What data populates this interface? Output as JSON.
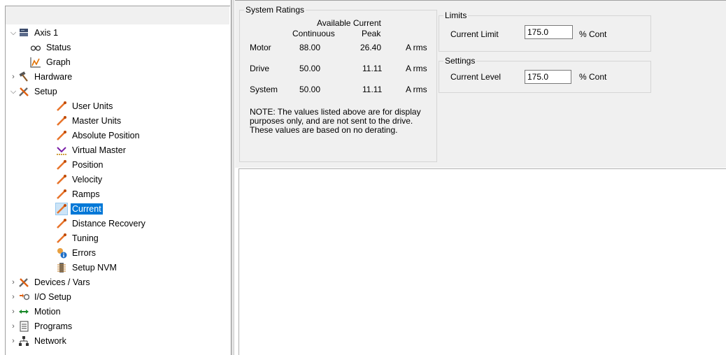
{
  "tree": {
    "nodes": [
      {
        "label": "Axis 1",
        "icon": "axis-drive-icon",
        "expander": "expanded"
      },
      {
        "label": "Status",
        "icon": "status-glasses-icon"
      },
      {
        "label": "Graph",
        "icon": "graph-icon"
      },
      {
        "label": "Hardware",
        "icon": "hammer-icon",
        "expander": "collapsed"
      },
      {
        "label": "Setup",
        "icon": "tools-icon",
        "expander": "expanded"
      },
      {
        "label": "User Units",
        "icon": "orange-tool-icon"
      },
      {
        "label": "Master Units",
        "icon": "orange-tool-icon"
      },
      {
        "label": "Absolute Position",
        "icon": "orange-tool-icon"
      },
      {
        "label": "Virtual Master",
        "icon": "virtual-master-icon"
      },
      {
        "label": "Position",
        "icon": "orange-tool-icon"
      },
      {
        "label": "Velocity",
        "icon": "orange-tool-icon"
      },
      {
        "label": "Ramps",
        "icon": "orange-tool-icon"
      },
      {
        "label": "Current",
        "icon": "orange-tool-icon",
        "selected": true
      },
      {
        "label": "Distance Recovery",
        "icon": "orange-tool-icon"
      },
      {
        "label": "Tuning",
        "icon": "orange-tool-icon"
      },
      {
        "label": "Errors",
        "icon": "errors-info-icon"
      },
      {
        "label": "Setup NVM",
        "icon": "nvm-memory-icon"
      },
      {
        "label": "Devices / Vars",
        "icon": "tools-icon",
        "expander": "collapsed"
      },
      {
        "label": "I/O Setup",
        "icon": "io-setup-icon",
        "expander": "collapsed"
      },
      {
        "label": "Motion",
        "icon": "motion-arrows-icon",
        "expander": "collapsed"
      },
      {
        "label": "Programs",
        "icon": "programs-icon",
        "expander": "collapsed"
      },
      {
        "label": "Network",
        "icon": "network-icon",
        "expander": "collapsed"
      }
    ]
  },
  "ratings": {
    "title": "System Ratings",
    "header_available": "Available Current",
    "header_continuous": "Continuous",
    "header_peak": "Peak",
    "rows": [
      {
        "name": "Motor",
        "continuous": "88.00",
        "peak": "26.40",
        "unit": "A rms"
      },
      {
        "name": "Drive",
        "continuous": "50.00",
        "peak": "11.11",
        "unit": "A rms"
      },
      {
        "name": "System",
        "continuous": "50.00",
        "peak": "11.11",
        "unit": "A rms"
      }
    ],
    "note": "NOTE:  The values listed above are for display purposes only, and are not sent to the drive.  These values are based on no derating."
  },
  "limits": {
    "title": "Limits",
    "label": "Current Limit",
    "value": "175.0",
    "unit": "% Cont"
  },
  "settings": {
    "title": "Settings",
    "label": "Current Level",
    "value": "175.0",
    "unit": "% Cont"
  }
}
